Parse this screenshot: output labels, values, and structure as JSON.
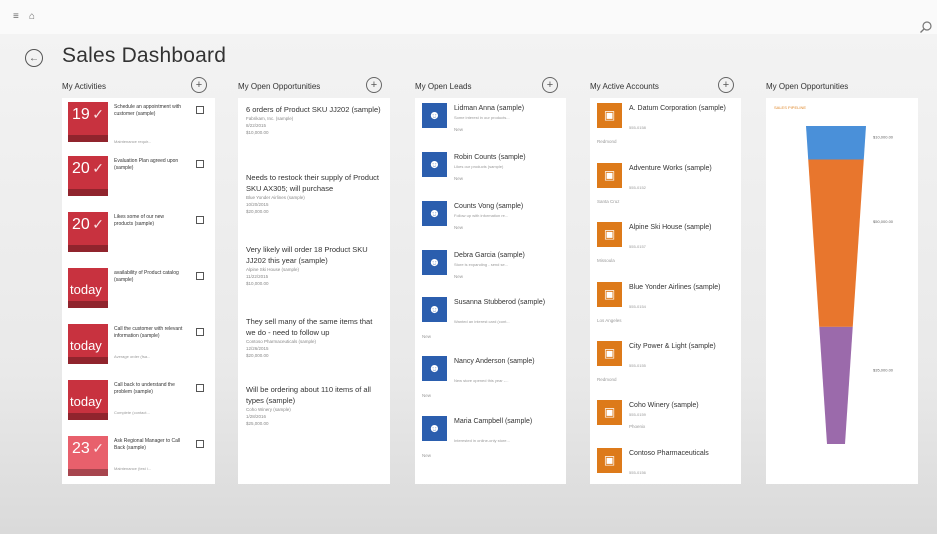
{
  "title": "Sales Dashboard",
  "colors": {
    "activity_red": "#c8323f",
    "activity_pink": "#e8606c",
    "lead_blue": "#2b5eae",
    "account_orange": "#dd7a1a",
    "funnel_blue": "#4a90d9",
    "funnel_orange": "#e8762d",
    "funnel_purple": "#9b6aab"
  },
  "columns": {
    "activities": "My Activities",
    "opportunities": "My Open Opportunities",
    "leads": "My Open Leads",
    "accounts": "My Active Accounts",
    "chart": "My Open Opportunities"
  },
  "activities": [
    {
      "tile": "19",
      "text": "Schedule an appointment with customer (sample)",
      "sub": "Maintenance requir...",
      "color": "#c8323f"
    },
    {
      "tile": "20",
      "text": "Evaluation Plan agreed upon (sample)",
      "sub": "",
      "color": "#c8323f"
    },
    {
      "tile": "20",
      "text": "Likes some of our new products (sample)",
      "sub": "",
      "color": "#c8323f"
    },
    {
      "tile": "today",
      "text": "availability of Product catalog (sample)",
      "sub": "",
      "color": "#c8323f"
    },
    {
      "tile": "today",
      "text": "Call the customer with relevant information (sample)",
      "sub": "Average order (fsa...",
      "color": "#c8323f"
    },
    {
      "tile": "today",
      "text": "Call back to understand the problem (sample)",
      "sub": "Complete (contact...",
      "color": "#c8323f"
    },
    {
      "tile": "23",
      "text": "Ask Regional Manager to Call Back (sample)",
      "sub": "Maintenance (test i...",
      "color": "#e8606c"
    }
  ],
  "opportunities": [
    {
      "title": "6 orders of Product SKU JJ202 (sample)",
      "meta": [
        "Fabrikam, Inc. (sample)",
        "8/22/2015",
        "$10,000.00"
      ]
    },
    {
      "title": "Needs to restock their supply of Product SKU AX305; will purchase",
      "meta": [
        "Blue Yonder Airlines (sample)",
        "10/20/2015",
        "$20,000.00"
      ]
    },
    {
      "title": "Very likely will order 18 Product SKU JJ202 this year (sample)",
      "meta": [
        "Alpine Ski House (sample)",
        "11/22/2015",
        "$10,000.00"
      ]
    },
    {
      "title": "They sell many of the same items that we do - need to follow up",
      "meta": [
        "Contoso Pharmaceuticals (sample)",
        "12/26/2015",
        "$20,000.00"
      ]
    },
    {
      "title": "Will be ordering about 110 items of all types (sample)",
      "meta": [
        "Coho Winery (sample)",
        "1/28/2016",
        "$25,000.00"
      ]
    }
  ],
  "leads": [
    {
      "name": "Lidman Anna (sample)",
      "sub": "Some interest in our products...",
      "foot": "New"
    },
    {
      "name": "Robin Counts (sample)",
      "sub": "Likes our products (sample)",
      "foot": "New"
    },
    {
      "name": "Counts Vong (sample)",
      "sub": "Follow up with information re...",
      "foot": "New"
    },
    {
      "name": "Debra Garcia (sample)",
      "sub": "Store is expanding - send se...",
      "foot": "New"
    },
    {
      "name": "Susanna Stubberod (sample)",
      "sub": "Wanted an interest card (cont...",
      "foot": "New"
    },
    {
      "name": "Nancy Anderson (sample)",
      "sub": "New store opened this year -...",
      "foot": "New"
    },
    {
      "name": "Maria Campbell (sample)",
      "sub": "Interested in online-only store...",
      "foot": "New"
    }
  ],
  "accounts": [
    {
      "name": "A. Datum Corporation (sample)",
      "sub": "555-0158",
      "foot": "Redmond"
    },
    {
      "name": "Adventure Works (sample)",
      "sub": "555-0152",
      "foot": "Santa Cruz"
    },
    {
      "name": "Alpine Ski House (sample)",
      "sub": "555-0157",
      "foot": "Missoula"
    },
    {
      "name": "Blue Yonder Airlines (sample)",
      "sub": "555-0154",
      "foot": "Los Angeles"
    },
    {
      "name": "City Power & Light (sample)",
      "sub": "555-0155",
      "foot": "Redmond"
    },
    {
      "name": "Coho Winery (sample)",
      "sub": "555-0159",
      "foot": "Phoenix"
    },
    {
      "name": "Contoso Pharmaceuticals",
      "sub": "555-0156",
      "foot": ""
    }
  ],
  "chart_data": {
    "type": "funnel",
    "title": "",
    "caption": "SALES PIPELINE",
    "stages": [
      {
        "label": "$10,000.00",
        "value": 10000,
        "color": "#4a90d9"
      },
      {
        "label": "$50,000.00",
        "value": 50000,
        "color": "#e8762d"
      },
      {
        "label": "$35,000.00",
        "value": 35000,
        "color": "#9b6aab"
      }
    ]
  },
  "icons": [
    "menu-icon",
    "home-icon",
    "search-icon",
    "back-arrow-icon",
    "plus-icon",
    "calendar-check-icon",
    "contact-card-icon",
    "account-card-icon"
  ]
}
